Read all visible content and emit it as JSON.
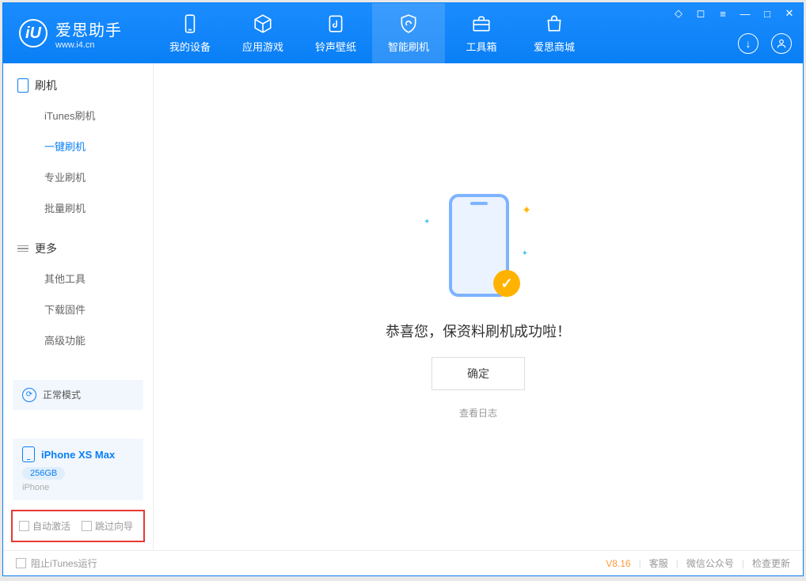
{
  "app": {
    "name_cn": "爱思助手",
    "name_en": "www.i4.cn"
  },
  "nav": {
    "tabs": [
      {
        "label": "我的设备"
      },
      {
        "label": "应用游戏"
      },
      {
        "label": "铃声壁纸"
      },
      {
        "label": "智能刷机"
      },
      {
        "label": "工具箱"
      },
      {
        "label": "爱思商城"
      }
    ]
  },
  "sidebar": {
    "section1_title": "刷机",
    "items1": [
      {
        "label": "iTunes刷机"
      },
      {
        "label": "一键刷机"
      },
      {
        "label": "专业刷机"
      },
      {
        "label": "批量刷机"
      }
    ],
    "section2_title": "更多",
    "items2": [
      {
        "label": "其他工具"
      },
      {
        "label": "下载固件"
      },
      {
        "label": "高级功能"
      }
    ]
  },
  "device": {
    "mode": "正常模式",
    "name": "iPhone XS Max",
    "capacity": "256GB",
    "type": "iPhone"
  },
  "options": {
    "auto_activate": "自动激活",
    "skip_guide": "跳过向导"
  },
  "main": {
    "message": "恭喜您，保资料刷机成功啦！",
    "confirm": "确定",
    "view_log": "查看日志"
  },
  "statusbar": {
    "block_itunes": "阻止iTunes运行",
    "version": "V8.16",
    "support": "客服",
    "wechat": "微信公众号",
    "check_update": "检查更新"
  }
}
